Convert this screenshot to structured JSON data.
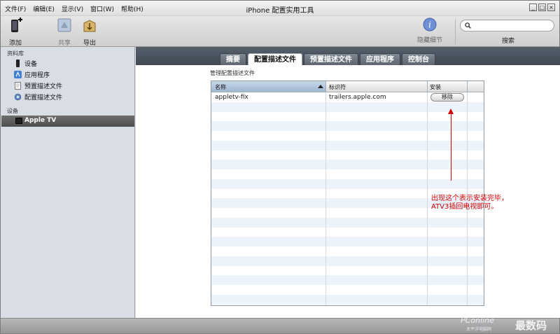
{
  "app": {
    "title": "iPhone 配置实用工具"
  },
  "menu": [
    "文件(F)",
    "编辑(E)",
    "显示(V)",
    "窗口(W)",
    "帮助(H)"
  ],
  "window_controls": [
    "_",
    "□",
    "×"
  ],
  "toolbar": {
    "add_label": "添加",
    "share_label": "共享",
    "export_label": "导出",
    "hide_details_label": "隐藏细节",
    "search_label": "搜索",
    "search_value": ""
  },
  "sidebar": {
    "library_heading": "资料库",
    "library_items": [
      {
        "label": "设备",
        "icon": "device-icon"
      },
      {
        "label": "应用程序",
        "icon": "app-store-icon"
      },
      {
        "label": "预置描述文件",
        "icon": "document-icon"
      },
      {
        "label": "配置描述文件",
        "icon": "gear-icon"
      }
    ],
    "devices_heading": "设备",
    "device_selected": "Apple TV"
  },
  "tabs": [
    "摘要",
    "配置描述文件",
    "预置描述文件",
    "应用程序",
    "控制台"
  ],
  "active_tab": 1,
  "main": {
    "section_title": "管理配置描述文件",
    "columns": [
      "名称",
      "标识符",
      "安装"
    ],
    "rows": [
      {
        "name": "appletv-fix",
        "identifier": "trailers.apple.com",
        "install_button": "移除"
      }
    ]
  },
  "annotation": {
    "line1": "出现这个表示安装完毕，",
    "line2": "ATV3插回电视即可。",
    "color": "#d10000"
  },
  "watermark": {
    "brand": "PConline",
    "sub": "太平洋电脑网",
    "logo_text": "最数码"
  }
}
